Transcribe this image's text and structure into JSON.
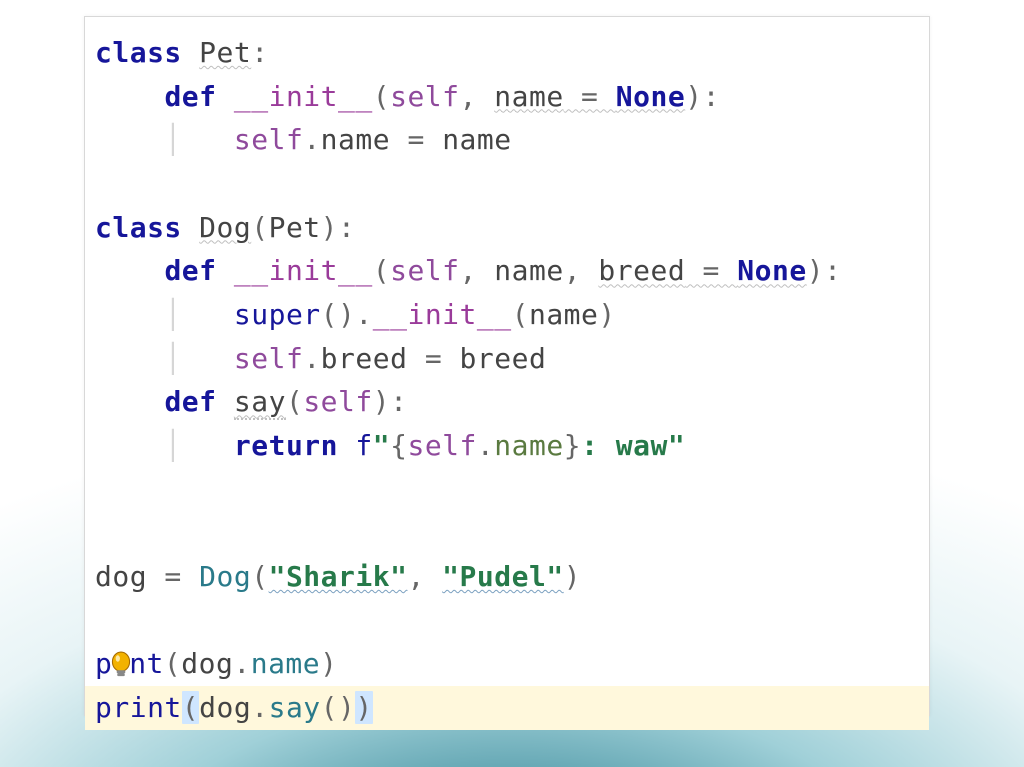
{
  "code": {
    "kw_class": "class",
    "kw_def": "def",
    "kw_return": "return",
    "kw_none": "None",
    "cls_pet": "Pet",
    "cls_dog": "Dog",
    "base_pet": "Pet",
    "dunder_init": "__init__",
    "self": "self",
    "param_name": "name",
    "param_breed": "breed",
    "attr_name": "name",
    "attr_breed": "breed",
    "fn_say": "say",
    "fn_super": "super",
    "fn_print": "print",
    "fprefix": "f",
    "fstr_open": "\"",
    "fstr_close": ": waw\"",
    "fint_open": "{",
    "fint_close": "}",
    "var_dog": "dog",
    "str_sharik": "\"Sharik\"",
    "str_pudel": "\"Pudel\"",
    "dot": ".",
    "eq": "=",
    "assign": " = ",
    "colon": ":",
    "comma": ", ",
    "lpar": "(",
    "rpar": ")",
    "call_name": "name",
    "call_say": "say"
  }
}
